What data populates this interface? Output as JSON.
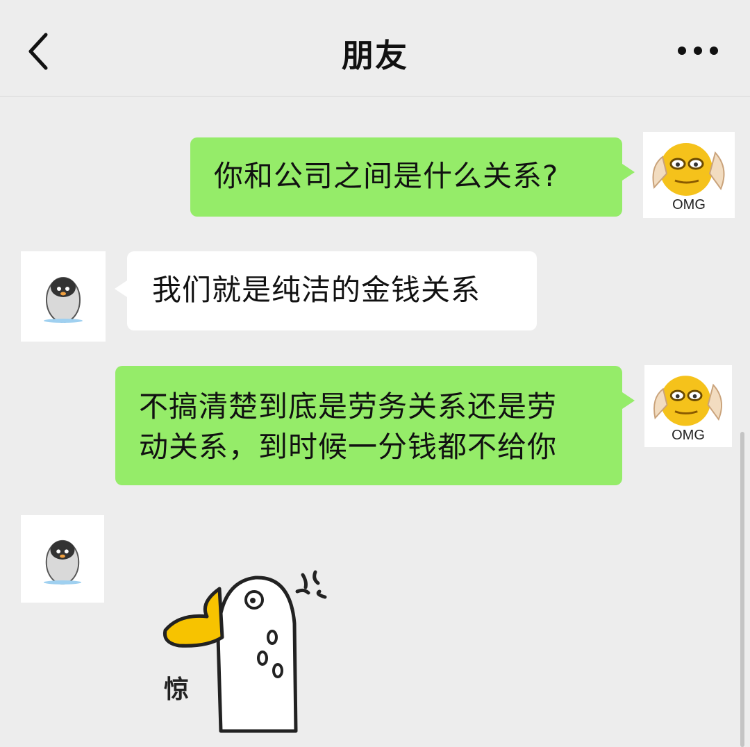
{
  "header": {
    "title": "朋友",
    "back_icon": "chevron-left-icon",
    "more_icon": "more-horizontal-icon"
  },
  "messages": [
    {
      "direction": "outgoing",
      "text": "你和公司之间是什么关系?",
      "avatar_caption": "OMG"
    },
    {
      "direction": "incoming",
      "text": "我们就是纯洁的金钱关系"
    },
    {
      "direction": "outgoing",
      "text_lines": [
        "不搞清楚到底是劳务关系还是劳",
        "动关系，到时候一分钱都不给你"
      ],
      "avatar_caption": "OMG"
    },
    {
      "direction": "incoming",
      "type": "sticker",
      "sticker_caption": "惊"
    }
  ],
  "colors": {
    "background": "#ededed",
    "outgoing_bubble": "#95ec69",
    "incoming_bubble": "#ffffff",
    "text": "#111111"
  }
}
